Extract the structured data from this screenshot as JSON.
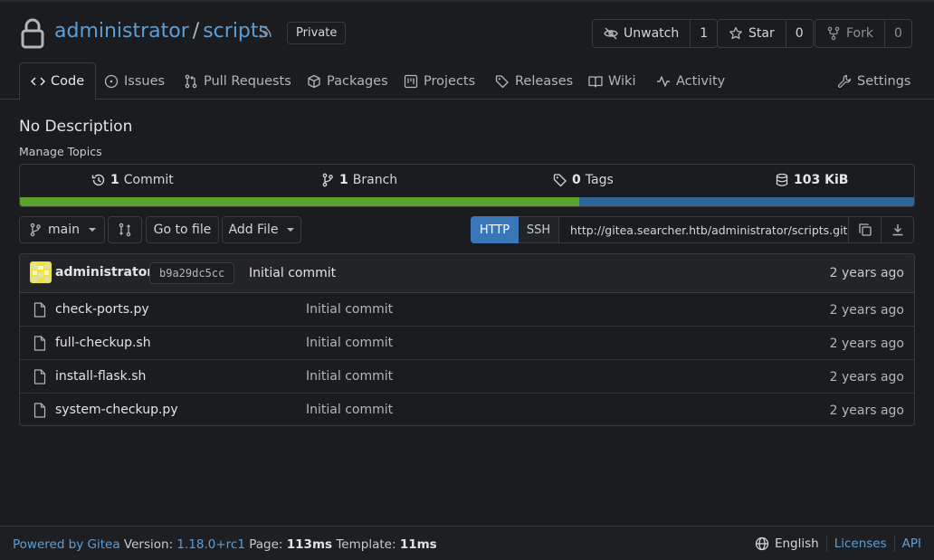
{
  "repo": {
    "owner": "administrator",
    "separator": "/",
    "name": "scripts",
    "visibility": "Private"
  },
  "actions": {
    "watch": {
      "label": "Unwatch",
      "count": "1"
    },
    "star": {
      "label": "Star",
      "count": "0"
    },
    "fork": {
      "label": "Fork",
      "count": "0"
    }
  },
  "tabs": {
    "code": "Code",
    "issues": "Issues",
    "pulls": "Pull Requests",
    "packages": "Packages",
    "projects": "Projects",
    "releases": "Releases",
    "wiki": "Wiki",
    "activity": "Activity",
    "settings": "Settings"
  },
  "description": "No Description",
  "manage_topics": "Manage Topics",
  "stats": {
    "commits_count": "1",
    "commits_label": "Commit",
    "branches_count": "1",
    "branches_label": "Branch",
    "tags_count": "0",
    "tags_label": "Tags",
    "size": "103 KiB"
  },
  "language_bar": {
    "fractions": [
      0.626,
      0.374
    ],
    "colors": [
      "#5aa02c",
      "#2f6595"
    ]
  },
  "toolbar": {
    "branch": "main",
    "go_to_file": "Go to file",
    "add_file": "Add File"
  },
  "clone": {
    "http": "HTTP",
    "ssh": "SSH",
    "url": "http://gitea.searcher.htb/administrator/scripts.git"
  },
  "latest_commit": {
    "author": "administrator",
    "sha": "b9a29dc5cc",
    "message": "Initial commit",
    "age": "2 years ago"
  },
  "files": [
    {
      "name": "check-ports.py",
      "message": "Initial commit",
      "age": "2 years ago"
    },
    {
      "name": "full-checkup.sh",
      "message": "Initial commit",
      "age": "2 years ago"
    },
    {
      "name": "install-flask.sh",
      "message": "Initial commit",
      "age": "2 years ago"
    },
    {
      "name": "system-checkup.py",
      "message": "Initial commit",
      "age": "2 years ago"
    }
  ],
  "footer": {
    "powered_by": "Powered by Gitea",
    "version_label": "Version:",
    "version": "1.18.0+rc1",
    "page_label": "Page:",
    "page_time": "113ms",
    "template_label": "Template:",
    "template_time": "11ms",
    "language": "English",
    "licenses": "Licenses",
    "api": "API"
  },
  "colors": {
    "accent": "#3a77b8",
    "link": "#5a9fd8",
    "background": "#1b1c1f"
  }
}
